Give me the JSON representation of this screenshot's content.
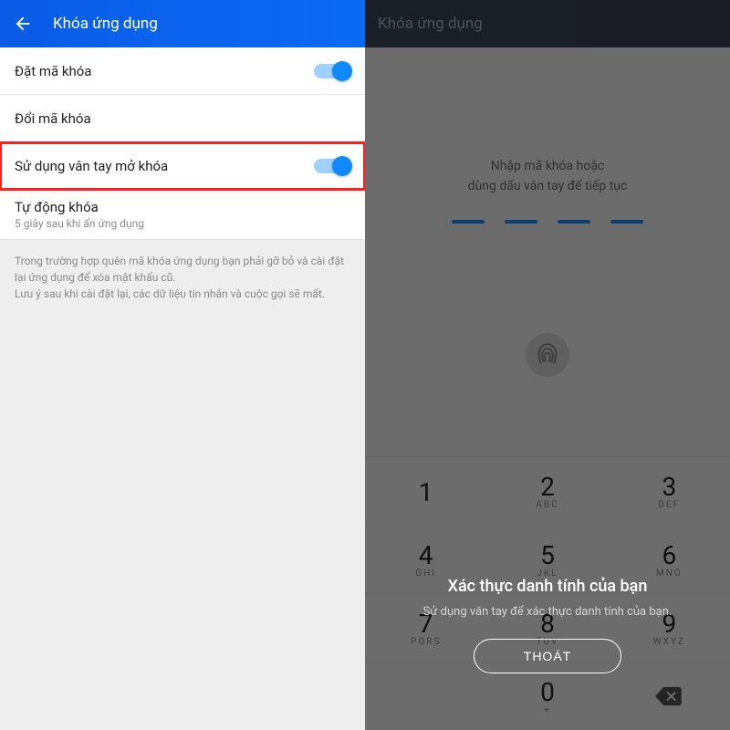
{
  "left": {
    "title": "Khóa ứng dụng",
    "rows": {
      "set_code": "Đặt mã khóa",
      "change_code": "Đổi mã khóa",
      "fingerprint": "Sử dụng vân tay mở khóa",
      "auto_lock": "Tự động khóa",
      "auto_lock_sub": "5 giây sau khi ẩn ứng dụng"
    },
    "info1": "Trong trường hợp quên mã khóa ứng dụng bạn phải gỡ bỏ và cài đặt lại ứng dụng để xóa mật khẩu cũ.",
    "info2": "Lưu ý sau khi cài đặt lại, các dữ liệu tin nhắn và cuộc gọi sẽ mất."
  },
  "right": {
    "title": "Khóa ứng dụng",
    "prompt1": "Nhập mã khóa hoặc",
    "prompt2": "dùng dấu vân tay để tiếp tục",
    "keypad": {
      "1": {
        "d": "1",
        "l": ""
      },
      "2": {
        "d": "2",
        "l": "ABC"
      },
      "3": {
        "d": "3",
        "l": "DEF"
      },
      "4": {
        "d": "4",
        "l": "GHI"
      },
      "5": {
        "d": "5",
        "l": "JKL"
      },
      "6": {
        "d": "6",
        "l": "MNO"
      },
      "7": {
        "d": "7",
        "l": "PQRS"
      },
      "8": {
        "d": "8",
        "l": "TUV"
      },
      "9": {
        "d": "9",
        "l": "WXYZ"
      },
      "0": {
        "d": "0",
        "l": "+"
      }
    },
    "dialog": {
      "title": "Xác thực danh tính của bạn",
      "body": "Sử dụng vân tay để xác thực danh tính của bạn.",
      "exit": "THOÁT"
    }
  }
}
